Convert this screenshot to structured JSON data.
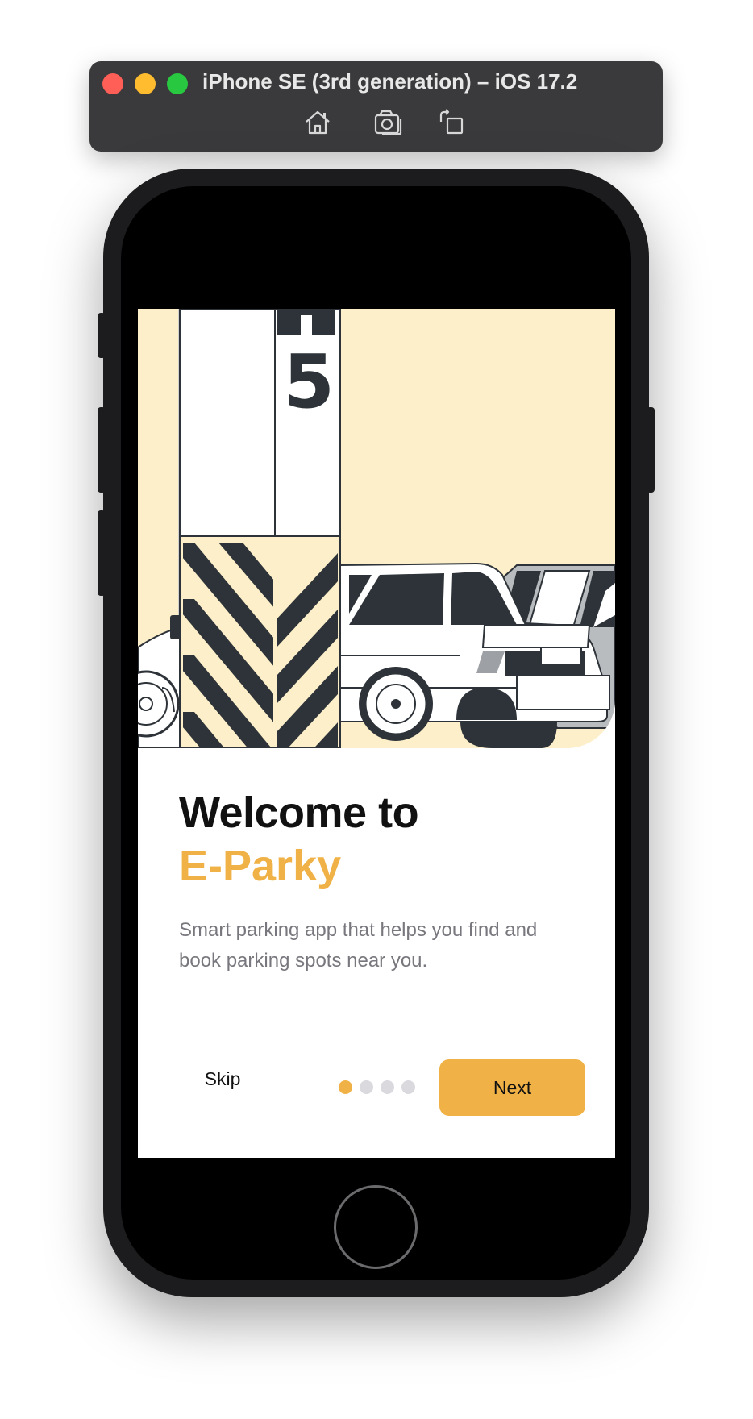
{
  "simulator": {
    "title": "iPhone SE (3rd generation) – iOS 17.2",
    "tools": [
      "home-icon",
      "screenshot-icon",
      "rotate-icon"
    ]
  },
  "hero": {
    "pillar_number": "5"
  },
  "onboarding": {
    "welcome_text": "Welcome to",
    "brand_name": "E-Parky",
    "description": "Smart parking app that helps you find and book parking spots near you.",
    "skip_label": "Skip",
    "next_label": "Next",
    "page_count": 4,
    "current_page": 1
  },
  "colors": {
    "accent": "#f0b246",
    "hero_background": "#fcefc9",
    "illustration_dark": "#2d3338"
  }
}
